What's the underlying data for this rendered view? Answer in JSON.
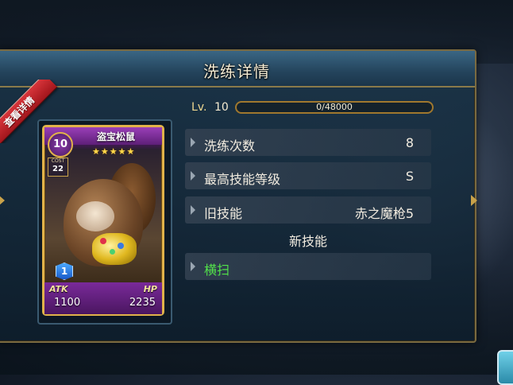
{
  "panel": {
    "title": "洗练详情",
    "ribbon_label": "查看详情"
  },
  "card": {
    "name": "盗宝松鼠",
    "stars": "★★★★★",
    "level": "10",
    "cost_label": "COST",
    "cost_value": "22",
    "rank": "1",
    "atk_label": "ATK",
    "atk_value": "1100",
    "hp_label": "HP",
    "hp_value": "2235"
  },
  "progress": {
    "lv_label": "Lv.",
    "lv_value": "10",
    "xp_text": "0/48000",
    "xp_fraction": 0.0
  },
  "rows": [
    {
      "label": "洗练次数",
      "value": "8"
    },
    {
      "label": "最高技能等级",
      "value": "S"
    },
    {
      "label": "旧技能",
      "value": "赤之魔枪5"
    }
  ],
  "new_skill": {
    "heading": "新技能",
    "skill_label": "横扫"
  },
  "colors": {
    "accent_gold": "#c9a24a",
    "new_skill_green": "#52e24a",
    "card_purple": "#7a2a9a"
  }
}
